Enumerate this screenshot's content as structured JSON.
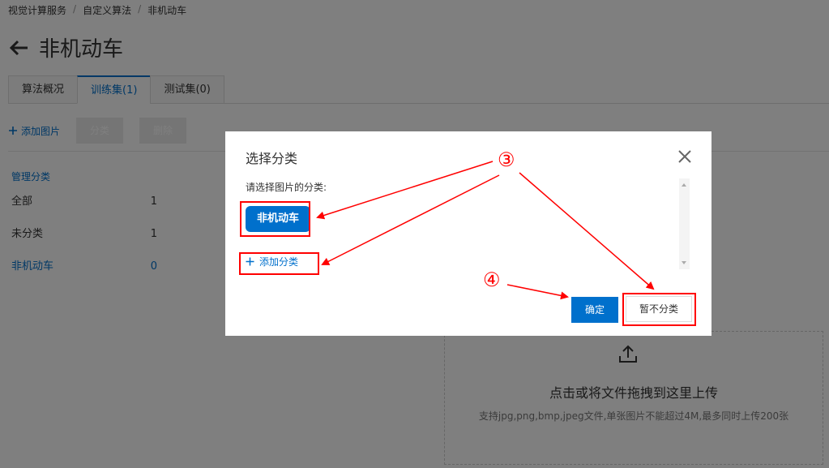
{
  "breadcrumb": [
    "视觉计算服务",
    "自定义算法",
    "非机动车"
  ],
  "breadcrumb_sep": "/",
  "page_title": "非机动车",
  "tabs": [
    {
      "label": "算法概况"
    },
    {
      "label": "训练集(1)"
    },
    {
      "label": "测试集(0)"
    }
  ],
  "toolbar": {
    "add_image": "添加图片",
    "classify": "分类",
    "delete": "删除"
  },
  "sidebar": {
    "header": "管理分类",
    "items": [
      {
        "label": "全部",
        "count": "1"
      },
      {
        "label": "未分类",
        "count": "1"
      },
      {
        "label": "非机动车",
        "count": "0"
      }
    ]
  },
  "upload": {
    "title": "点击或将文件拖拽到这里上传",
    "hint": "支持jpg,png,bmp,jpeg文件,单张图片不能超过4M,最多同时上传200张"
  },
  "modal": {
    "title": "选择分类",
    "label": "请选择图片的分类:",
    "category": "非机动车",
    "add_category": "添加分类",
    "confirm": "确定",
    "no_category": "暂不分类"
  },
  "annotations": {
    "step3": "③",
    "step4": "④",
    "color": "#ff0000"
  },
  "colors": {
    "accent": "#0070cc",
    "overlay": "rgba(0,0,0,0.5)"
  }
}
